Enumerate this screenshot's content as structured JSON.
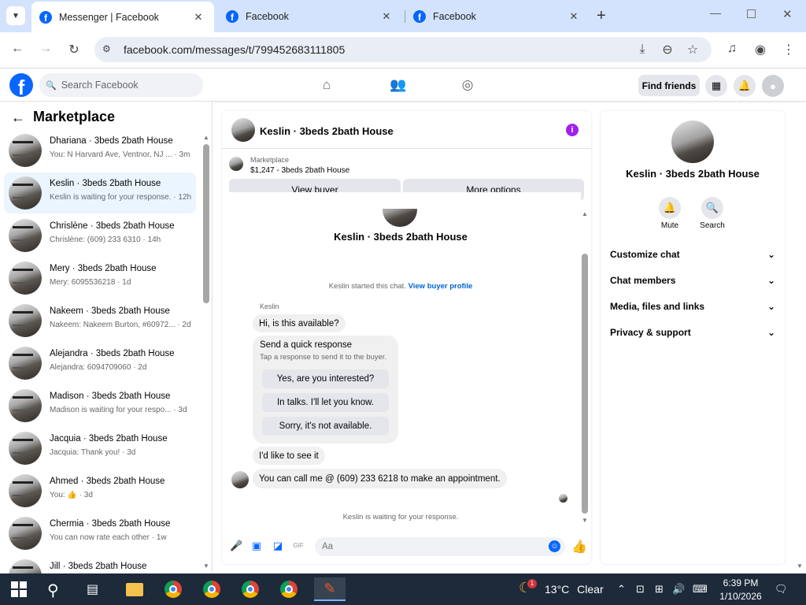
{
  "browser": {
    "tabs": [
      {
        "title": "Messenger | Facebook",
        "active": true
      },
      {
        "title": "Facebook",
        "active": false
      },
      {
        "title": "Facebook",
        "active": false
      }
    ],
    "url": "facebook.com/messages/t/799452683111805"
  },
  "fb_header": {
    "search_placeholder": "Search Facebook",
    "find_friends": "Find friends"
  },
  "left_panel": {
    "title": "Marketplace",
    "conversations": [
      {
        "name": "Dhariana · 3beds 2bath House",
        "snippet": "You: N Harvard Ave, Ventnor, NJ ... · 3m",
        "selected": false
      },
      {
        "name": "Keslin · 3beds 2bath House",
        "snippet": "Keslin is waiting for your response. · 12h",
        "selected": true
      },
      {
        "name": "Chrislène · 3beds 2bath House",
        "snippet": "Chrislène: (609) 233 6310 · 14h",
        "selected": false
      },
      {
        "name": "Mery · 3beds 2bath House",
        "snippet": "Mery: 6095536218 · 1d",
        "selected": false
      },
      {
        "name": "Nakeem · 3beds 2bath House",
        "snippet": "Nakeem: Nakeem Burton, #60972... · 2d",
        "selected": false
      },
      {
        "name": "Alejandra · 3beds 2bath House",
        "snippet": "Alejandra: 6094709060 · 2d",
        "selected": false
      },
      {
        "name": "Madison · 3beds 2bath House",
        "snippet": "Madison is waiting for your respo... · 3d",
        "selected": false
      },
      {
        "name": "Jacquia · 3beds 2bath House",
        "snippet": "Jacquia: Thank you! · 3d",
        "selected": false
      },
      {
        "name": "Ahmed · 3beds 2bath House",
        "snippet": "You: 👍 · 3d",
        "selected": false
      },
      {
        "name": "Chermia · 3beds 2bath House",
        "snippet": "You can now rate each other · 1w",
        "selected": false
      },
      {
        "name": "Jill · 3beds 2bath House",
        "snippet": "",
        "selected": false
      }
    ]
  },
  "chat": {
    "header_name": "Keslin · 3beds 2bath House",
    "marketplace_label": "Marketplace",
    "listing": "$1,247 - 3beds 2bath House",
    "view_buyer": "View buyer",
    "more_options": "More options",
    "center_name": "Keslin · 3beds 2bath House",
    "started_text": "Keslin started this chat.",
    "view_buyer_profile": "View buyer profile",
    "sender": "Keslin",
    "messages": {
      "m1": "Hi, is this available?",
      "m2": "I'd like to see it",
      "m3": "You can call me @ (609) 233 6218 to make an appointment."
    },
    "quick_response": {
      "title": "Send a quick response",
      "subtitle": "Tap a response to send it to the buyer.",
      "options": [
        "Yes, are you interested?",
        "In talks. I'll let you know.",
        "Sorry, it's not available."
      ]
    },
    "waiting": "Keslin is waiting for your response.",
    "composer_placeholder": "Aa"
  },
  "right_panel": {
    "name": "Keslin · 3beds 2bath House",
    "mute": "Mute",
    "search": "Search",
    "sections": [
      "Customize chat",
      "Chat members",
      "Media, files and links",
      "Privacy & support"
    ]
  },
  "taskbar": {
    "temperature": "13°C",
    "weather": "Clear",
    "time": "6:39 PM",
    "date": "1/10/2026",
    "weather_badge": "1"
  },
  "colors": {
    "fb_blue": "#0866ff",
    "selected_row": "#ebf5ff",
    "info_purple": "#a020f0",
    "tab_strip": "#d3e3fd"
  }
}
